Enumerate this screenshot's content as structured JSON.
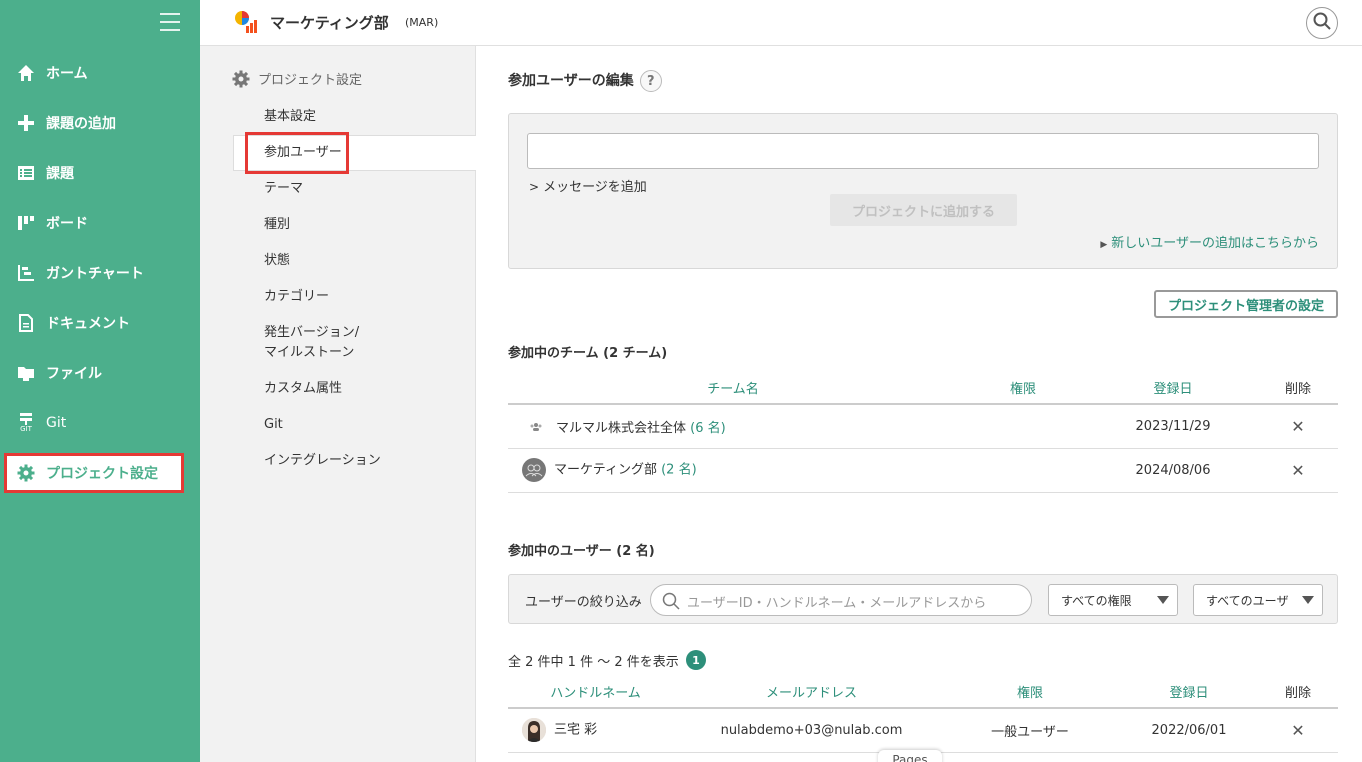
{
  "sidebar": {
    "items": [
      {
        "label": "ホーム",
        "icon": "home-icon"
      },
      {
        "label": "課題の追加",
        "icon": "plus-icon"
      },
      {
        "label": "課題",
        "icon": "list-icon"
      },
      {
        "label": "ボード",
        "icon": "board-icon"
      },
      {
        "label": "ガントチャート",
        "icon": "gantt-icon"
      },
      {
        "label": "ドキュメント",
        "icon": "document-icon"
      },
      {
        "label": "ファイル",
        "icon": "folder-icon"
      },
      {
        "label": "Git",
        "icon": "git-icon"
      },
      {
        "label": "プロジェクト設定",
        "icon": "gear-icon"
      }
    ],
    "git_caption": "GIT"
  },
  "header": {
    "project_name": "マーケティング部",
    "project_key": "(MAR)"
  },
  "settings_nav": {
    "title": "プロジェクト設定",
    "items": [
      "基本設定",
      "参加ユーザー",
      "テーマ",
      "種別",
      "状態",
      "カテゴリー",
      "発生バージョン/",
      "マイルストーン",
      "カスタム属性",
      "Git",
      "インテグレーション"
    ]
  },
  "main": {
    "edit_title": "参加ユーザーの編集",
    "help": "?",
    "add_message_link": "メッセージを追加",
    "add_button": "プロジェクトに追加する",
    "new_user_link": "新しいユーザーの追加はこちらから",
    "admin_button": "プロジェクト管理者の設定",
    "teams_title": "参加中のチーム (2 チーム)",
    "teams_headers": [
      "チーム名",
      "権限",
      "登録日",
      "削除"
    ],
    "teams": [
      {
        "name": "マルマル株式会社全体",
        "count": "(6 名)",
        "date": "2023/11/29",
        "delete": "✕"
      },
      {
        "name": "マーケティング部",
        "count": "(2 名)",
        "date": "2024/08/06",
        "delete": "✕"
      }
    ],
    "users_title": "参加中のユーザー (2 名)",
    "filter_label": "ユーザーの絞り込み",
    "filter_placeholder": "ユーザーID・ハンドルネーム・メールアドレスから",
    "role_select": "すべての権限",
    "user_select": "すべてのユーザ",
    "count_text": "全 2 件中 1 件 〜 2 件を表示",
    "page": "1",
    "users_headers": [
      "ハンドルネーム",
      "メールアドレス",
      "権限",
      "登録日",
      "削除"
    ],
    "users": [
      {
        "name": "三宅 彩",
        "email": "nulabdemo+03@nulab.com",
        "role": "一般ユーザー",
        "date": "2022/06/01",
        "delete": "✕"
      }
    ],
    "pages_tab": "Pages"
  },
  "colors": {
    "brand": "#4caf8c",
    "accent": "#2d8f7a",
    "highlight": "#e53935"
  }
}
